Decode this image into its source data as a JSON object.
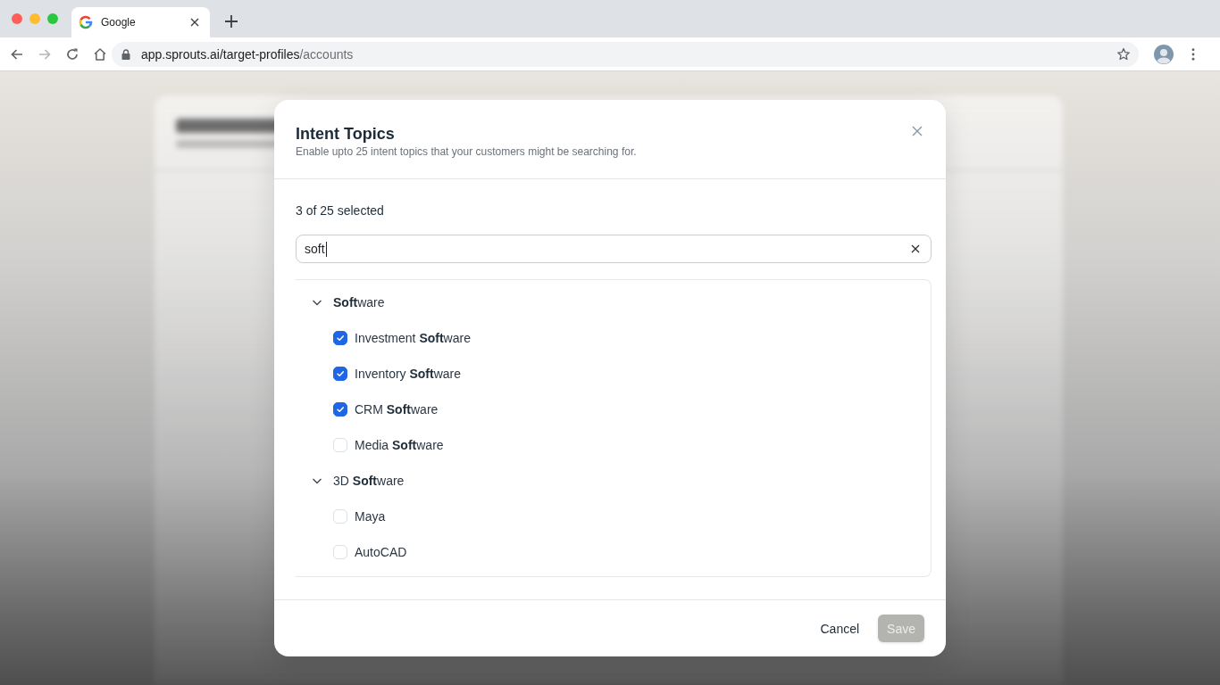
{
  "browser": {
    "tabs": [
      {
        "title": "Google",
        "selected": true
      }
    ],
    "address": {
      "main": "app.sprouts.ai/target-profiles",
      "dim": "/accounts"
    }
  },
  "dialog": {
    "title": "Intent Topics",
    "subtitle": "Enable upto 25 intent topics that your customers might be searching for.",
    "selection_count": "3 of 25 selected",
    "search": {
      "value": "soft"
    },
    "groups": [
      {
        "label": "**Soft**ware",
        "expanded": true,
        "children": [
          {
            "label": "Investment **Soft**ware",
            "checked": true
          },
          {
            "label": "Inventory **Soft**ware",
            "checked": true
          },
          {
            "label": "CRM **Soft**ware",
            "checked": true
          },
          {
            "label": "Media **Soft**ware",
            "checked": false
          }
        ]
      },
      {
        "label": "3D **Soft**ware",
        "expanded": true,
        "children": [
          {
            "label": "Maya",
            "checked": false
          },
          {
            "label": "AutoCAD",
            "checked": false
          }
        ]
      }
    ],
    "buttons": [
      {
        "label": "Cancel",
        "kind": "secondary",
        "disabled": false
      },
      {
        "label": "Save",
        "kind": "primary",
        "disabled": true
      }
    ]
  }
}
